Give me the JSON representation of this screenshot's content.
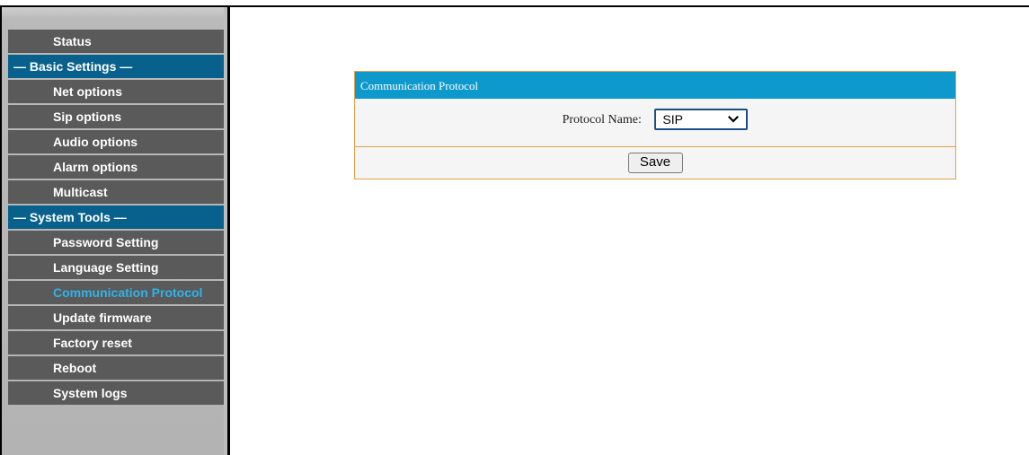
{
  "sidebar": {
    "items": [
      {
        "label": "Status",
        "kind": "link"
      },
      {
        "label": "— Basic Settings —",
        "kind": "section"
      },
      {
        "label": "Net options",
        "kind": "link"
      },
      {
        "label": "Sip options",
        "kind": "link"
      },
      {
        "label": "Audio options",
        "kind": "link"
      },
      {
        "label": "Alarm options",
        "kind": "link"
      },
      {
        "label": "Multicast",
        "kind": "link"
      },
      {
        "label": "— System Tools —",
        "kind": "section"
      },
      {
        "label": "Password Setting",
        "kind": "link"
      },
      {
        "label": "Language Setting",
        "kind": "link"
      },
      {
        "label": "Communication Protocol",
        "kind": "link",
        "active": true
      },
      {
        "label": "Update firmware",
        "kind": "link"
      },
      {
        "label": "Factory reset",
        "kind": "link"
      },
      {
        "label": "Reboot",
        "kind": "link"
      },
      {
        "label": "System logs",
        "kind": "link"
      }
    ]
  },
  "panel": {
    "title": "Communication Protocol",
    "protocol_label": "Protocol Name:",
    "protocol_value": "SIP",
    "save_label": "Save"
  },
  "colors": {
    "menu_item_bg": "#5a5a5a",
    "section_bg": "#07618c",
    "active_text": "#2fb3ea",
    "panel_header_bg": "#0e99cc",
    "panel_border": "#e2a24a",
    "select_border": "#1a4f86"
  },
  "icons": {
    "select_arrow": "chevron-down-icon"
  }
}
